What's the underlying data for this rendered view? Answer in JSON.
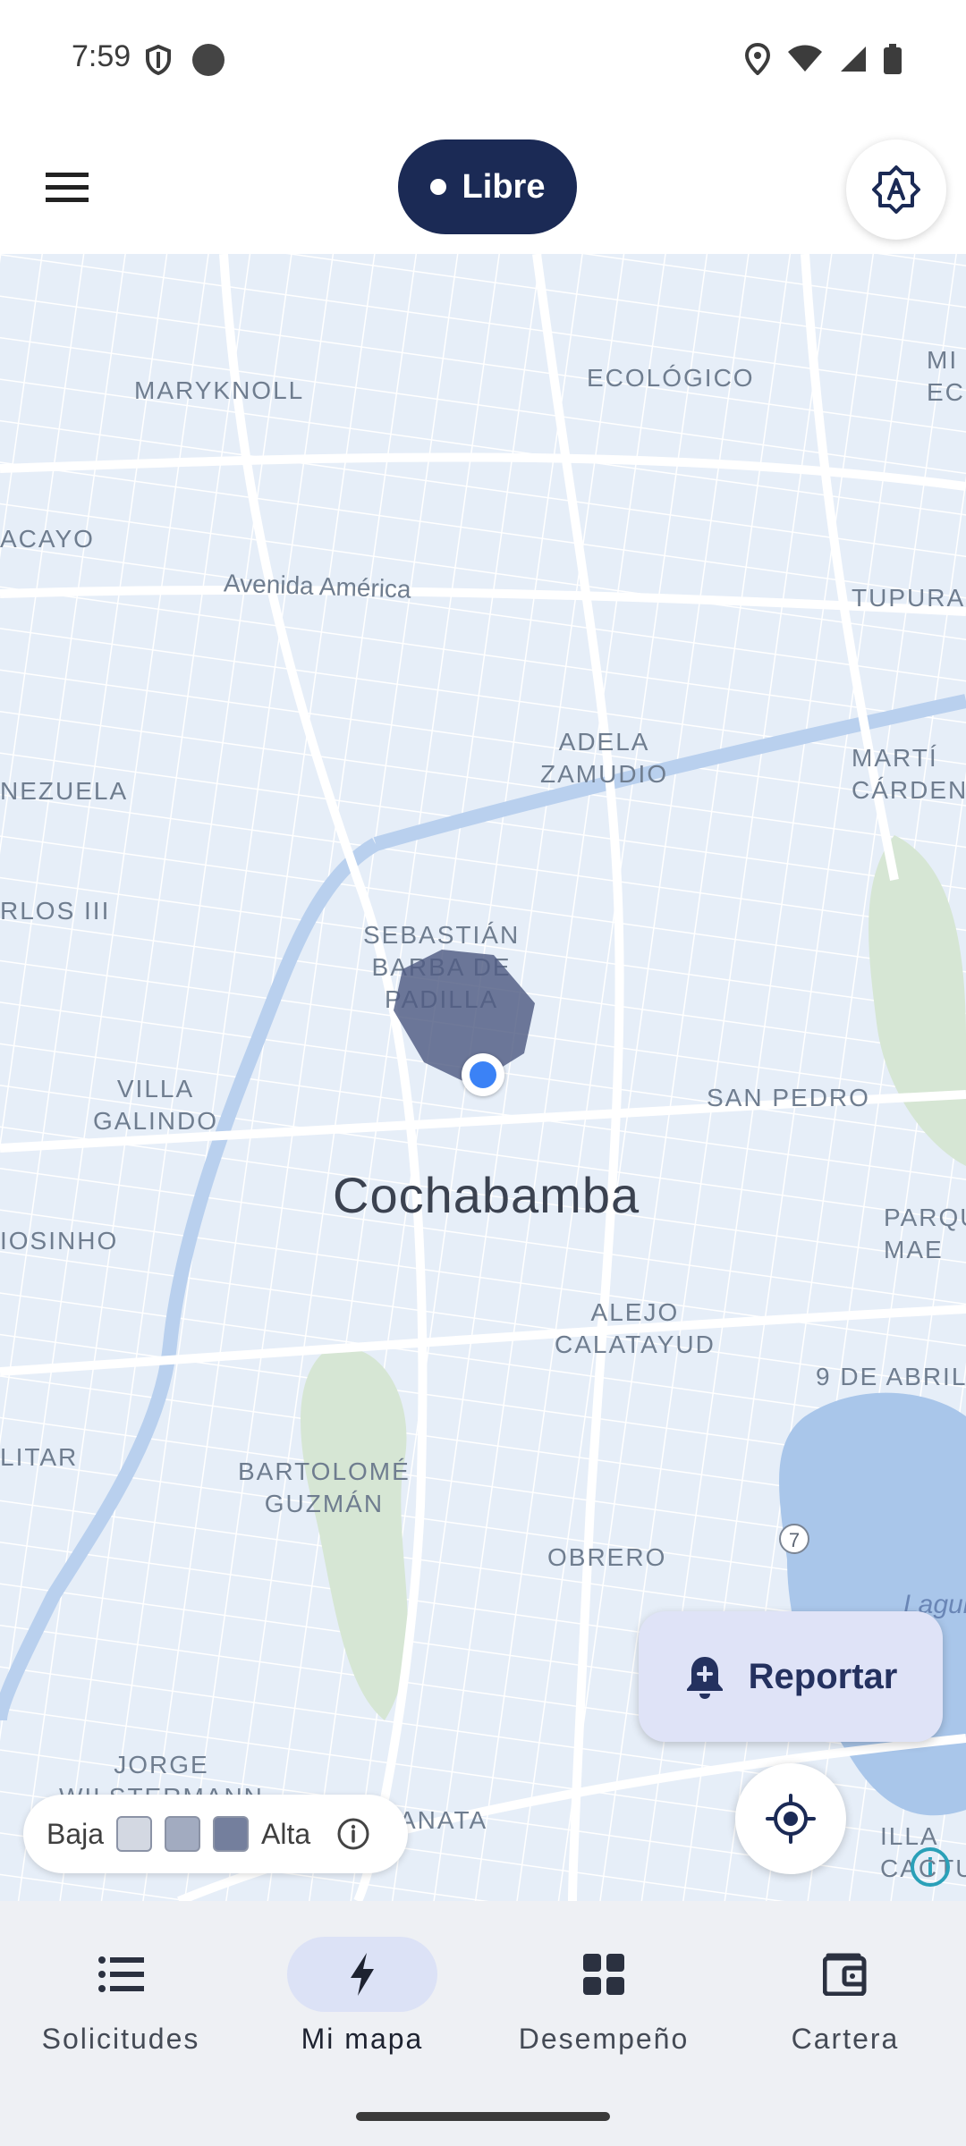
{
  "status_bar": {
    "time": "7:59"
  },
  "app_bar": {
    "driver_status": "Libre"
  },
  "map": {
    "city": "Cochabamba",
    "street": "Avenida América",
    "neighborhoods": [
      "MARYKNOLL",
      "ECOLÓGICO",
      "MI\nECO",
      "ACAYO",
      "TUPURA",
      "ADELA\nZAMUDIO",
      "MARTÍ\nCÁRDEN",
      "NEZUELA",
      "RLOS III",
      "SEBASTIÁN\nBARBA DE\nPADILLA",
      "SAN PEDRO",
      "VILLA\nGALINDO",
      "PARQU\nMAE",
      "IOSINHO",
      "ALEJO\nCALATAYUD",
      "9 DE ABRIL",
      "LITAR",
      "BARTOLOMÉ\nGUZMÁN",
      "OBRERO",
      "JORGE\nWILSTERMANN",
      "ANATA",
      "ILLA\nCACTU"
    ],
    "water_label": "Laguna",
    "route_shield": "7"
  },
  "report_button": {
    "label": "Reportar"
  },
  "legend": {
    "low": "Baja",
    "high": "Alta",
    "colors": [
      "#d3d8e2",
      "#a2abc0",
      "#747f9d"
    ]
  },
  "bottom_nav": {
    "items": [
      {
        "label": "Solicitudes",
        "icon": "list-icon"
      },
      {
        "label": "Mi mapa",
        "icon": "bolt-icon"
      },
      {
        "label": "Desempeño",
        "icon": "dashboard-icon"
      },
      {
        "label": "Cartera",
        "icon": "wallet-icon"
      }
    ]
  }
}
